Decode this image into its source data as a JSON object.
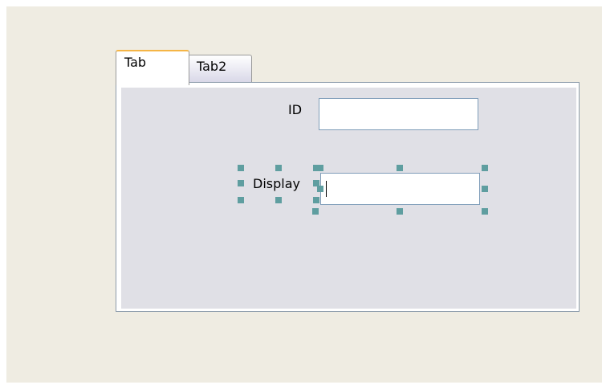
{
  "tabs": [
    {
      "label": "Tab",
      "active": true
    },
    {
      "label": "Tab2",
      "active": false
    }
  ],
  "form": {
    "id_label": "ID",
    "id_value": "",
    "display_label": "Display",
    "display_value": ""
  },
  "colors": {
    "canvas": "#efece2",
    "panel": "#e0e0e6",
    "active_tab_accent": "#f5b546",
    "selection_handle": "#5f9ea0"
  },
  "icons": {
    "selection_handle": "square-handle-icon",
    "text_caret": "text-caret-icon"
  }
}
